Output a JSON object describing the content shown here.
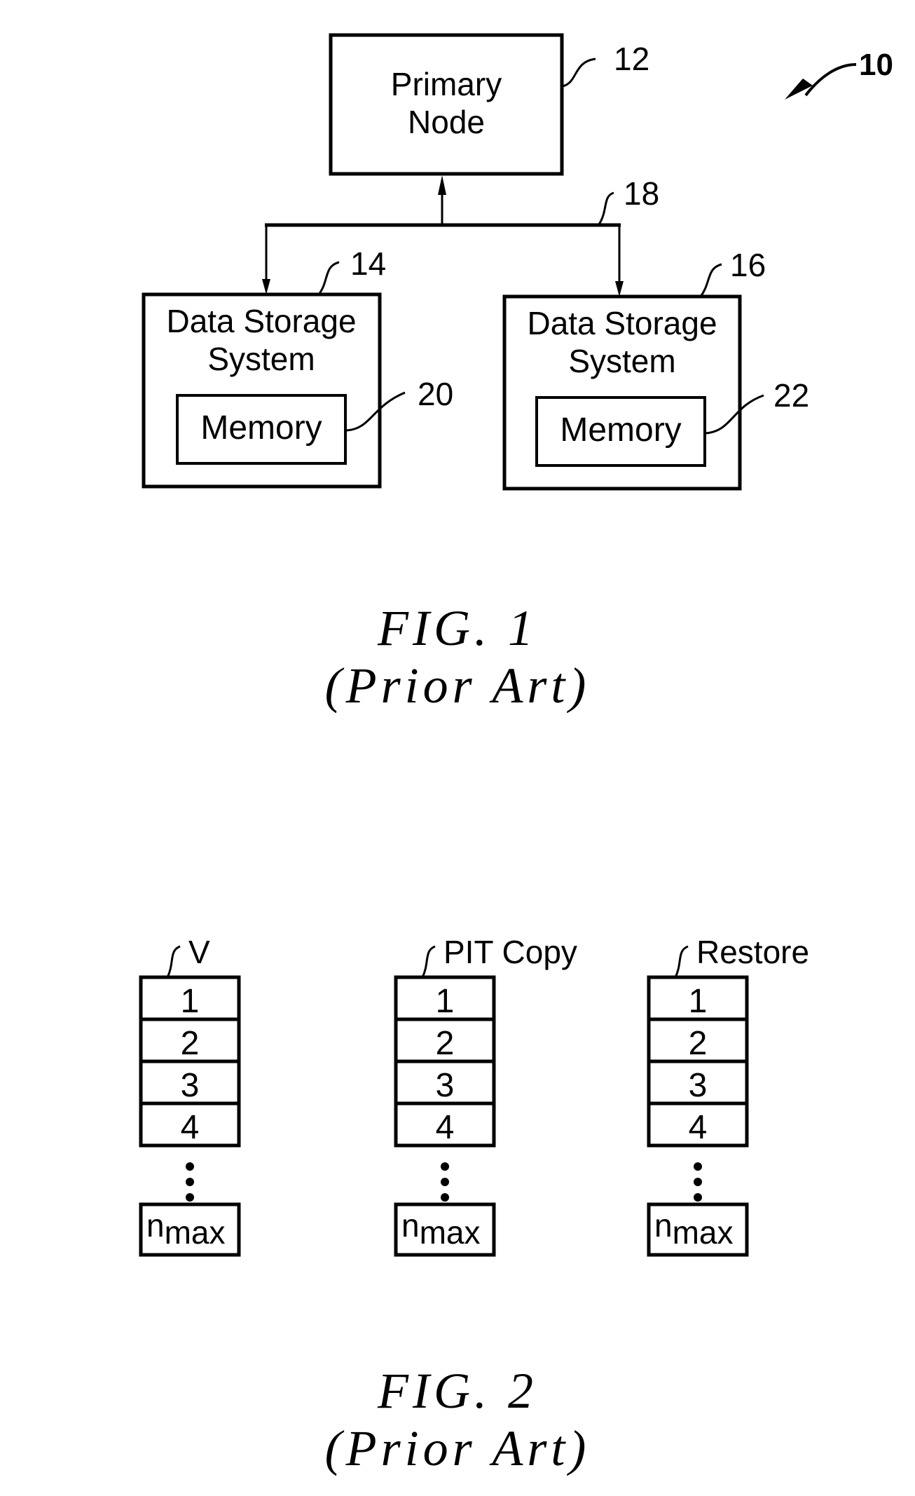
{
  "figure1": {
    "ref_system": "10",
    "primary_node": {
      "line1": "Primary",
      "line2": "Node",
      "ref": "12"
    },
    "bus_ref": "18",
    "storage_left": {
      "line1": "Data Storage",
      "line2": "System",
      "ref": "14",
      "memory": {
        "label": "Memory",
        "ref": "20"
      }
    },
    "storage_right": {
      "line1": "Data Storage",
      "line2": "System",
      "ref": "16",
      "memory": {
        "label": "Memory",
        "ref": "22"
      }
    },
    "caption": {
      "title": "FIG.  1",
      "subtitle": "(Prior  Art)"
    }
  },
  "figure2": {
    "columns": [
      {
        "label": "V",
        "cells": [
          "1",
          "2",
          "3",
          "4"
        ],
        "last": "n",
        "last_sub": "max"
      },
      {
        "label": "PIT Copy",
        "cells": [
          "1",
          "2",
          "3",
          "4"
        ],
        "last": "n",
        "last_sub": "max"
      },
      {
        "label": "Restore",
        "cells": [
          "1",
          "2",
          "3",
          "4"
        ],
        "last": "n",
        "last_sub": "max"
      }
    ],
    "caption": {
      "title": "FIG.  2",
      "subtitle": "(Prior  Art)"
    }
  }
}
